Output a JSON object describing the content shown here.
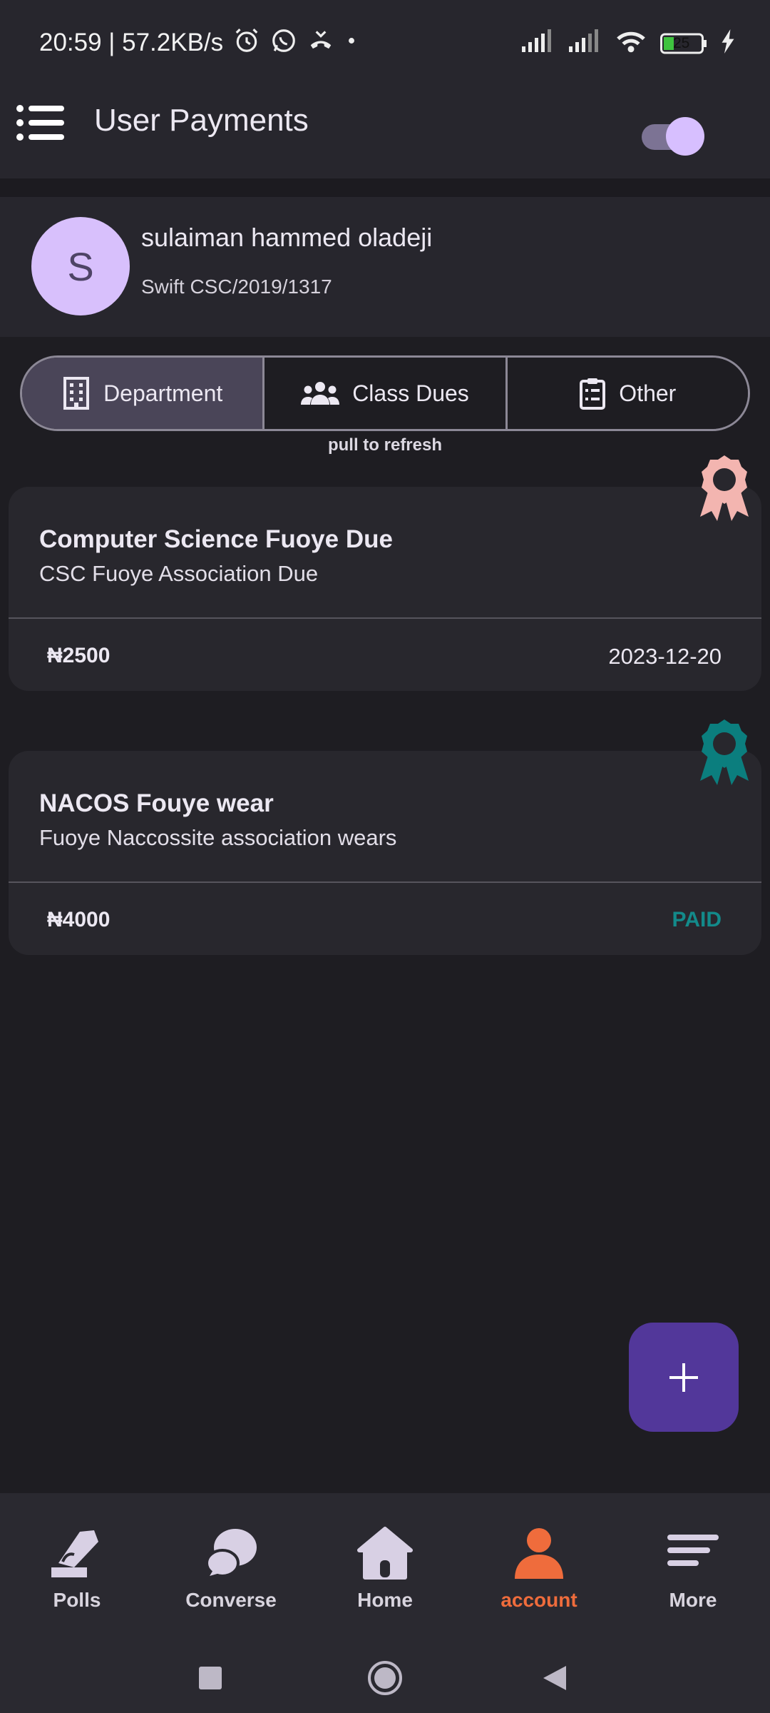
{
  "status_bar": {
    "time_speed": "20:59 | 57.2KB/s",
    "battery": "25"
  },
  "app_bar": {
    "title": "User Payments"
  },
  "profile": {
    "avatar_letter": "S",
    "name": "sulaiman hammed oladeji",
    "id": "Swift CSC/2019/1317"
  },
  "tabs": [
    {
      "label": "Department",
      "icon": "building-icon",
      "active": true
    },
    {
      "label": "Class Dues",
      "icon": "group-icon",
      "active": false
    },
    {
      "label": "Other",
      "icon": "clipboard-list-icon",
      "active": false
    }
  ],
  "pull_hint": "pull to refresh",
  "payments": [
    {
      "title": "Computer Science Fuoye Due",
      "subtitle": "CSC Fuoye Association Due",
      "amount": "₦2500",
      "due_date": "2023-12-20",
      "badge_color": "#f3b5b0"
    },
    {
      "title": "NACOS Fouye wear",
      "subtitle": "Fuoye Naccossite association wears",
      "amount": "₦4000",
      "status": "PAID",
      "badge_color": "#0b7e7e",
      "status_color": "#138a8a"
    }
  ],
  "fab": {
    "icon": "plus-icon"
  },
  "bottom_nav": [
    {
      "label": "Polls",
      "icon": "polls-icon"
    },
    {
      "label": "Converse",
      "icon": "chat-bubbles-icon"
    },
    {
      "label": "Home",
      "icon": "home-icon"
    },
    {
      "label": "account",
      "icon": "person-icon",
      "active": true
    },
    {
      "label": "More",
      "icon": "menu-lines-icon"
    }
  ],
  "colors": {
    "accent": "#ef6c3c",
    "fab": "#52379a",
    "avatar": "#d8c0fc"
  }
}
